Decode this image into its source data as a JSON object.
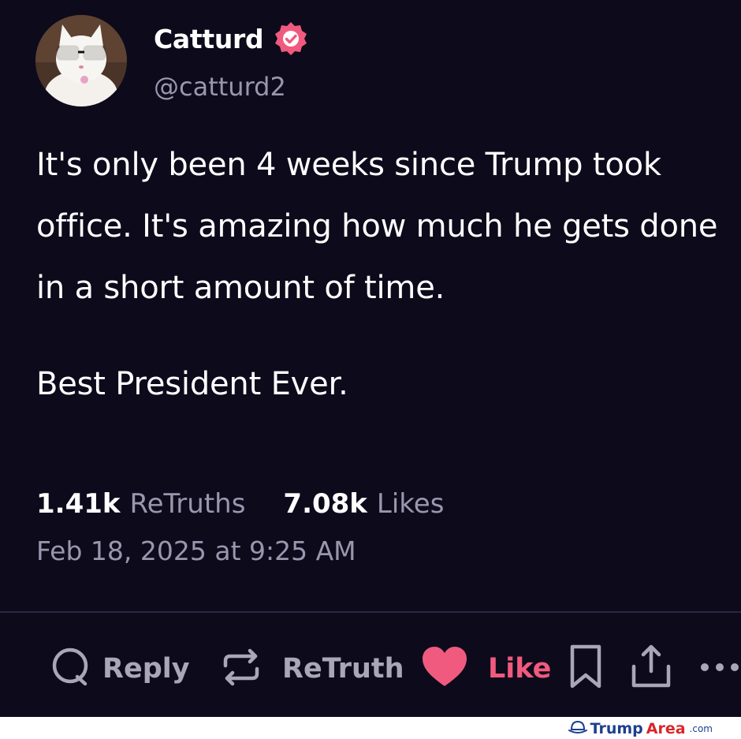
{
  "author": {
    "display_name": "Catturd",
    "handle": "@catturd2",
    "verified": true
  },
  "post": {
    "paragraphs": [
      "It's only been 4 weeks since Trump took office. It's amazing how much he gets done in a short amount of time.",
      "Best President Ever."
    ],
    "retruths_count": "1.41k",
    "retruths_label": "ReTruths",
    "likes_count": "7.08k",
    "likes_label": "Likes",
    "timestamp": "Feb 18, 2025 at 9:25 AM"
  },
  "actions": {
    "reply_label": "Reply",
    "retruth_label": "ReTruth",
    "like_label": "Like"
  },
  "watermark": {
    "part1": "Trump",
    "part2": "Area",
    "part3": ".com"
  },
  "colors": {
    "background": "#0d0a1b",
    "accent_pink": "#f05a7e",
    "muted": "#9a96ad"
  },
  "icons": [
    "verified-badge-icon",
    "reply-icon",
    "retruth-icon",
    "heart-icon",
    "bookmark-icon",
    "share-icon",
    "more-icon"
  ]
}
